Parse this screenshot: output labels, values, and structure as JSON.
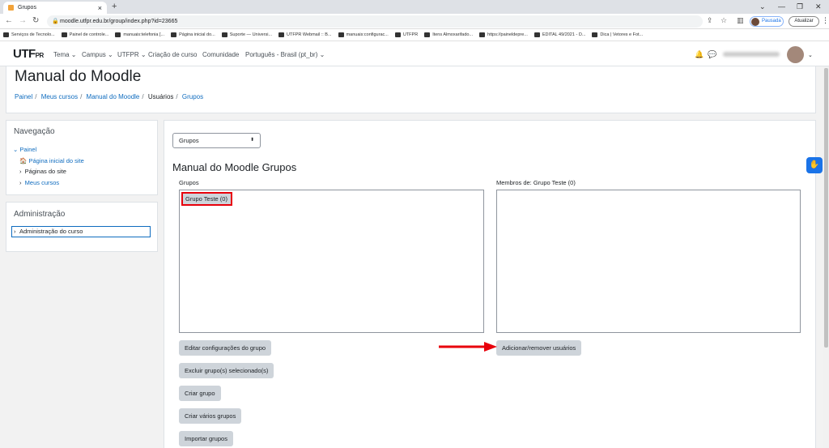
{
  "browser": {
    "tab_title": "Grupos",
    "url": "moodle.utfpr.edu.br/group/index.php?id=23665",
    "profile_label": "Pausada",
    "update_label": "Atualizar",
    "bookmarks": [
      "Serviços de Tecnolo...",
      "Painel de controle...",
      "manuais:telefonia [...",
      "Página inicial do...",
      "Suporte — Universi...",
      "UTFPR Webmail :: B...",
      "manuais:configurac...",
      "UTFPR",
      "Itens Almoxarifado...",
      "https://paineldepre...",
      "EDITAL 49/2021 - D...",
      "Dica | Vetores e Fot..."
    ]
  },
  "moodle_nav": {
    "logo": "UTF",
    "logo_suffix": "PR",
    "links": [
      "Tema ⌄",
      "Campus ⌄",
      "UTFPR ⌄",
      "Criação de curso",
      "Comunidade",
      "Português - Brasil (pt_br) ⌄"
    ]
  },
  "header": {
    "title": "Manual do Moodle",
    "breadcrumb": [
      "Painel",
      "Meus cursos",
      "Manual do Moodle",
      "Usuários",
      "Grupos"
    ]
  },
  "navigation_block": {
    "title": "Navegação",
    "painel": "Painel",
    "home": "Página inicial do site",
    "pages": "Páginas do site",
    "my_courses": "Meus cursos"
  },
  "admin_block": {
    "title": "Administração",
    "course_admin": "Administração do curso"
  },
  "main": {
    "select_value": "Grupos",
    "title": "Manual do Moodle Grupos",
    "groups_label": "Grupos",
    "members_label": "Membros de: Grupo Teste (0)",
    "group_option": "Grupo Teste (0)",
    "buttons": {
      "edit": "Editar configurações do grupo",
      "delete": "Excluir grupo(s) selecionado(s)",
      "create": "Criar grupo",
      "create_many": "Criar vários grupos",
      "import": "Importar grupos",
      "add_remove": "Adicionar/remover usuários"
    }
  },
  "colors": {
    "highlight": "#e8000b",
    "link": "#0f6cbf",
    "button": "#ced4da"
  }
}
